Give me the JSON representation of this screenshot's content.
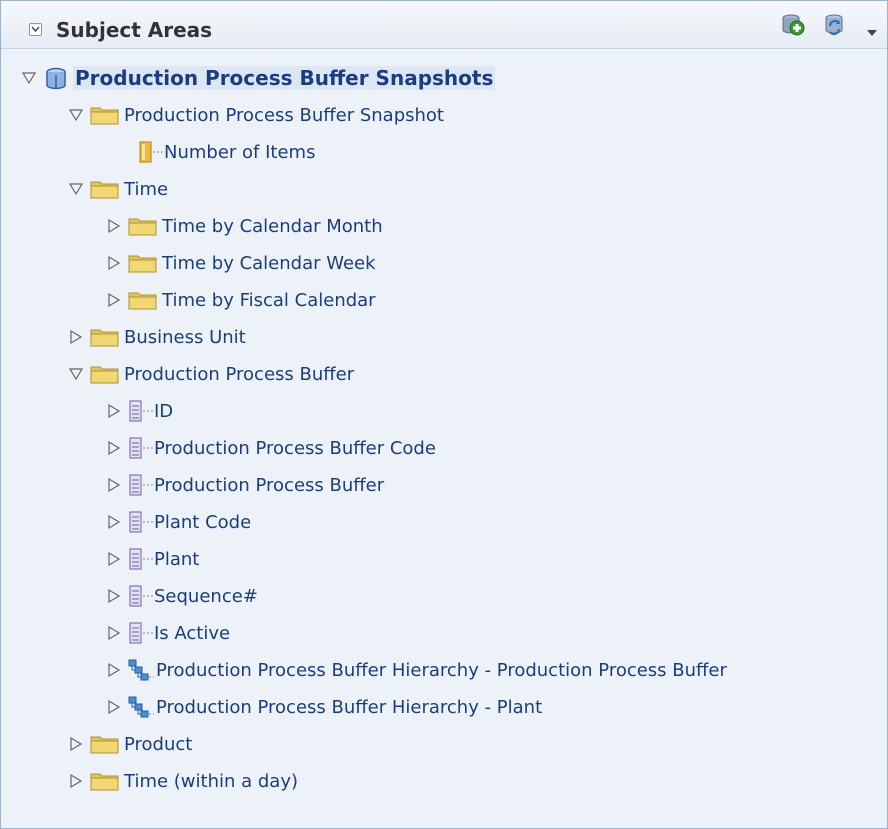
{
  "header": {
    "title": "Subject Areas",
    "icons": [
      "add-subject-area-icon",
      "refresh-icon",
      "menu-arrow-icon"
    ]
  },
  "tree": [
    {
      "label": "Production Process Buffer Snapshots",
      "level": 0,
      "expander": "expanded",
      "icon": "subject-area-icon"
    },
    {
      "label": "Production Process Buffer Snapshot",
      "level": 1,
      "expander": "expanded",
      "icon": "folder-icon"
    },
    {
      "label": "Number of Items",
      "level": 2,
      "expander": "none",
      "icon": "measure-icon"
    },
    {
      "label": "Time",
      "level": 1,
      "expander": "expanded",
      "icon": "folder-icon"
    },
    {
      "label": "Time by Calendar Month",
      "level": 2,
      "expander": "collapsed",
      "icon": "folder-icon"
    },
    {
      "label": "Time by Calendar Week",
      "level": 2,
      "expander": "collapsed",
      "icon": "folder-icon"
    },
    {
      "label": "Time by Fiscal Calendar",
      "level": 2,
      "expander": "collapsed",
      "icon": "folder-icon"
    },
    {
      "label": "Business Unit",
      "level": 1,
      "expander": "collapsed",
      "icon": "folder-icon"
    },
    {
      "label": "Production Process Buffer",
      "level": 1,
      "expander": "expanded",
      "icon": "folder-icon"
    },
    {
      "label": "ID",
      "level": 2,
      "expander": "collapsed",
      "icon": "attribute-icon"
    },
    {
      "label": "Production Process Buffer Code",
      "level": 2,
      "expander": "collapsed",
      "icon": "attribute-icon"
    },
    {
      "label": "Production Process Buffer",
      "level": 2,
      "expander": "collapsed",
      "icon": "attribute-icon"
    },
    {
      "label": "Plant Code",
      "level": 2,
      "expander": "collapsed",
      "icon": "attribute-icon"
    },
    {
      "label": "Plant",
      "level": 2,
      "expander": "collapsed",
      "icon": "attribute-icon"
    },
    {
      "label": "Sequence#",
      "level": 2,
      "expander": "collapsed",
      "icon": "attribute-icon"
    },
    {
      "label": "Is Active",
      "level": 2,
      "expander": "collapsed",
      "icon": "attribute-icon"
    },
    {
      "label": "Production Process Buffer Hierarchy - Production Process Buffer",
      "level": 2,
      "expander": "collapsed",
      "icon": "hierarchy-icon"
    },
    {
      "label": "Production Process Buffer Hierarchy - Plant",
      "level": 2,
      "expander": "collapsed",
      "icon": "hierarchy-icon"
    },
    {
      "label": "Product",
      "level": 1,
      "expander": "collapsed",
      "icon": "folder-icon"
    },
    {
      "label": "Time (within a day)",
      "level": 1,
      "expander": "collapsed",
      "icon": "folder-icon"
    }
  ]
}
